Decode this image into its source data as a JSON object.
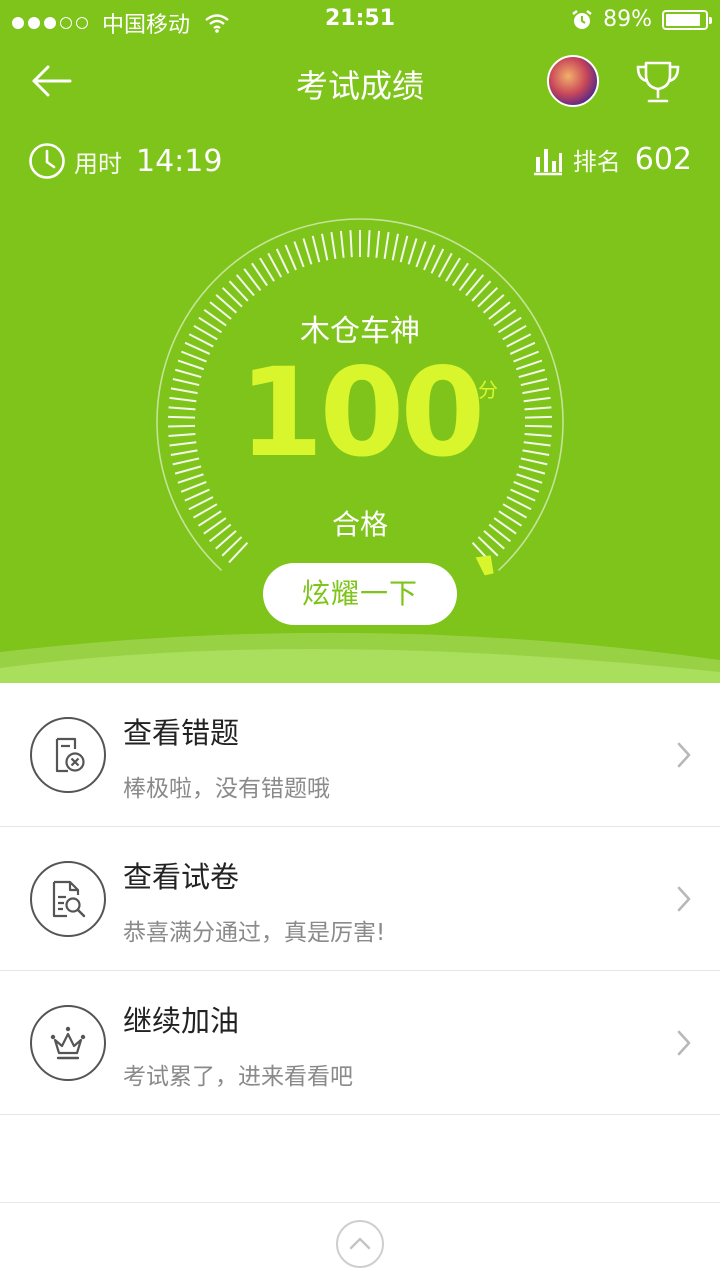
{
  "status_bar": {
    "carrier": "中国移动",
    "time": "21:51",
    "battery": "89%",
    "battery_level": 0.89,
    "signal_bars_filled": 3,
    "signal_bars_total": 5
  },
  "nav": {
    "title": "考试成绩"
  },
  "stats": {
    "time_label": "用时",
    "time_value": "14:19",
    "rank_label": "排名",
    "rank_value": "602"
  },
  "score": {
    "title": "木仓车神",
    "value": "100",
    "unit": "分",
    "status": "合格"
  },
  "share_button": "炫耀一下",
  "list": [
    {
      "title": "查看错题",
      "subtitle": "棒极啦，没有错题哦",
      "icon": "wrong-questions-icon"
    },
    {
      "title": "查看试卷",
      "subtitle": "恭喜满分通过，真是厉害!",
      "icon": "review-paper-icon"
    },
    {
      "title": "继续加油",
      "subtitle": "考试累了，进来看看吧",
      "icon": "crown-icon"
    }
  ],
  "colors": {
    "primary_green": "#7ec41a",
    "score_yellow": "#d9f52c",
    "text_dark": "#222222",
    "text_gray": "#8a8a8a"
  }
}
